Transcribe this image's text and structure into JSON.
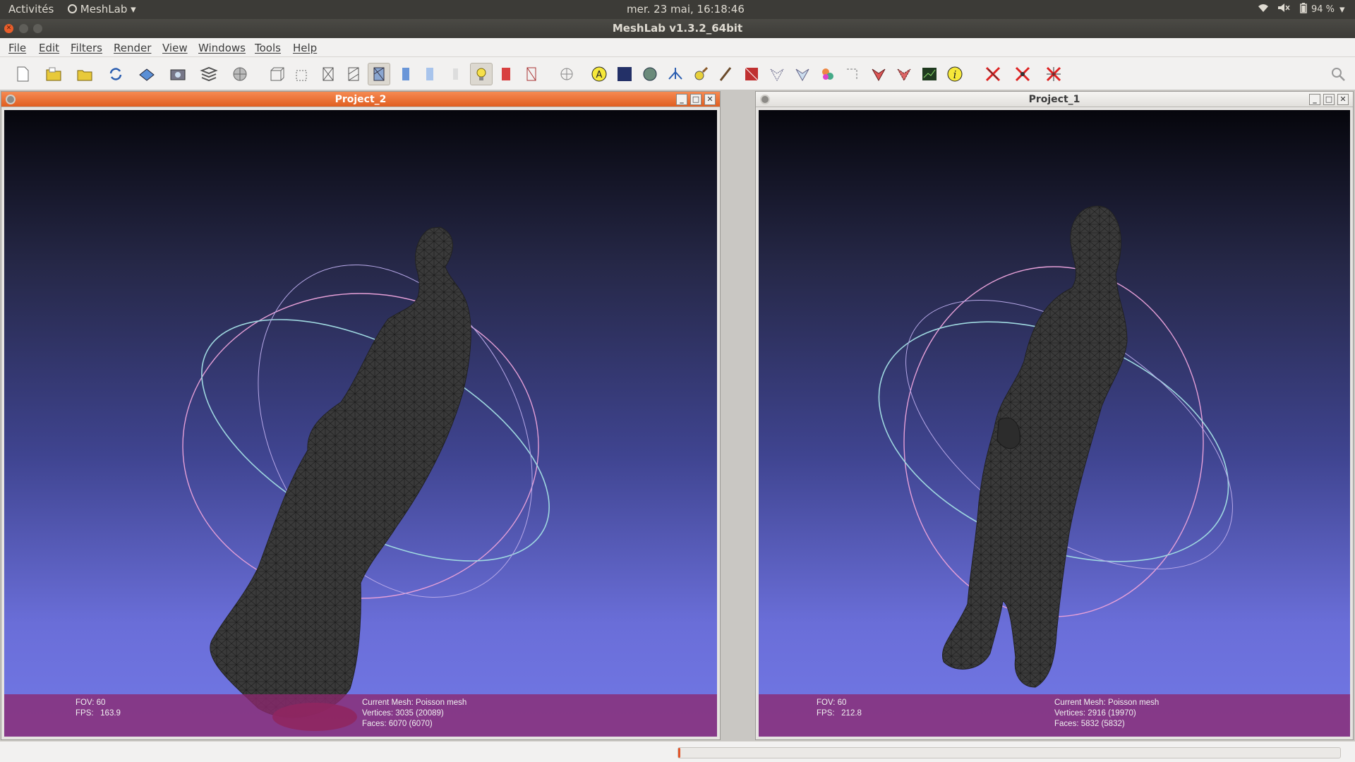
{
  "system_bar": {
    "activities": "Activités",
    "app_menu": "MeshLab",
    "clock": "mer. 23 mai, 16:18:46",
    "battery": "94 %",
    "icons": [
      "wifi-icon",
      "volume-muted-icon",
      "battery-icon",
      "system-menu-arrow-icon"
    ]
  },
  "window": {
    "title": "MeshLab v1.3.2_64bit"
  },
  "menu": [
    "File",
    "Edit",
    "Filters",
    "Render",
    "View",
    "Windows",
    "Tools",
    "Help"
  ],
  "toolbar": {
    "tools": [
      "new-document",
      "open-folder",
      "open-project",
      "reload",
      "save",
      "snapshot",
      "layers",
      "layer-sphere",
      "bounding-box",
      "points",
      "wireframe",
      "hidden-lines",
      "flat-lines",
      "flat",
      "smooth",
      "texture",
      "light",
      "color",
      "fancy-lighting",
      "manipulator",
      "annotate",
      "frame",
      "sphere-sample",
      "align",
      "paint",
      "attribute-color",
      "select-faces",
      "select-vertices",
      "pick-points",
      "quality-mapper",
      "reference-points",
      "select-connected",
      "measure",
      "raster",
      "info",
      "delete-faces",
      "delete-vertices",
      "delete-all"
    ],
    "active_tools": [
      "flat-lines",
      "light"
    ],
    "search_icon": "search-icon"
  },
  "windows": [
    {
      "title": "Project_2",
      "active": true,
      "fov_label": "FOV:",
      "fov": "60",
      "fps_label": "FPS:",
      "fps": "163.9",
      "current_mesh": "Current Mesh: Poisson mesh",
      "vertices": "Vertices: 3035 (20089)",
      "faces": "Faces: 6070 (6070)"
    },
    {
      "title": "Project_1",
      "active": false,
      "fov_label": "FOV:",
      "fov": "60",
      "fps_label": "FPS:",
      "fps": "212.8",
      "current_mesh": "Current Mesh: Poisson mesh",
      "vertices": "Vertices: 2916 (19970)",
      "faces": "Faces: 5832 (5832)"
    }
  ],
  "colors": {
    "accent": "#e0612a",
    "info_bar": "#8c286e",
    "trackball_blue": "#9fd8e0",
    "trackball_pink": "#e6a0d8",
    "mesh": "#3a3a3a"
  },
  "progress": {
    "value": 0.003
  }
}
